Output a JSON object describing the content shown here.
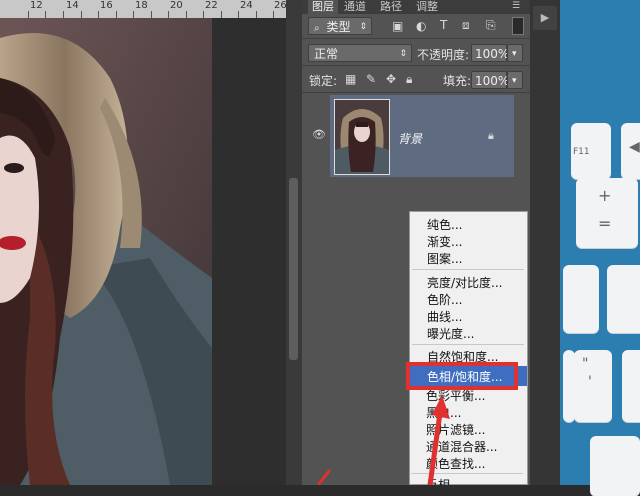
{
  "ruler": {
    "ticks": [
      "12",
      "14",
      "16",
      "18",
      "20",
      "22",
      "24",
      "26"
    ]
  },
  "panel": {
    "tabs": [
      "图层",
      "通道",
      "路径",
      "调整"
    ],
    "filter_kind": "类型",
    "blend_mode": "正常",
    "opacity_label": "不透明度:",
    "opacity_value": "100%",
    "lock_label": "锁定:",
    "fill_label": "填充:",
    "fill_value": "100%",
    "layer_name": "背景"
  },
  "context_menu": {
    "items": [
      "纯色...",
      "渐变...",
      "图案...",
      "亮度/对比度...",
      "色阶...",
      "曲线...",
      "曝光度...",
      "自然饱和度...",
      "色相/饱和度...",
      "色彩平衡...",
      "黑白...",
      "照片滤镜...",
      "通道混合器...",
      "颜色查找...",
      "反相"
    ],
    "selected": "色相/饱和度..."
  },
  "keyboard": {
    "f11": "F11",
    "plus": "+",
    "equals": "=",
    "quote": "\"",
    "apostrophe": "'"
  },
  "colors": {
    "highlight": "#3f6ec0",
    "annotation_red": "#e03030",
    "panel": "#535353"
  }
}
